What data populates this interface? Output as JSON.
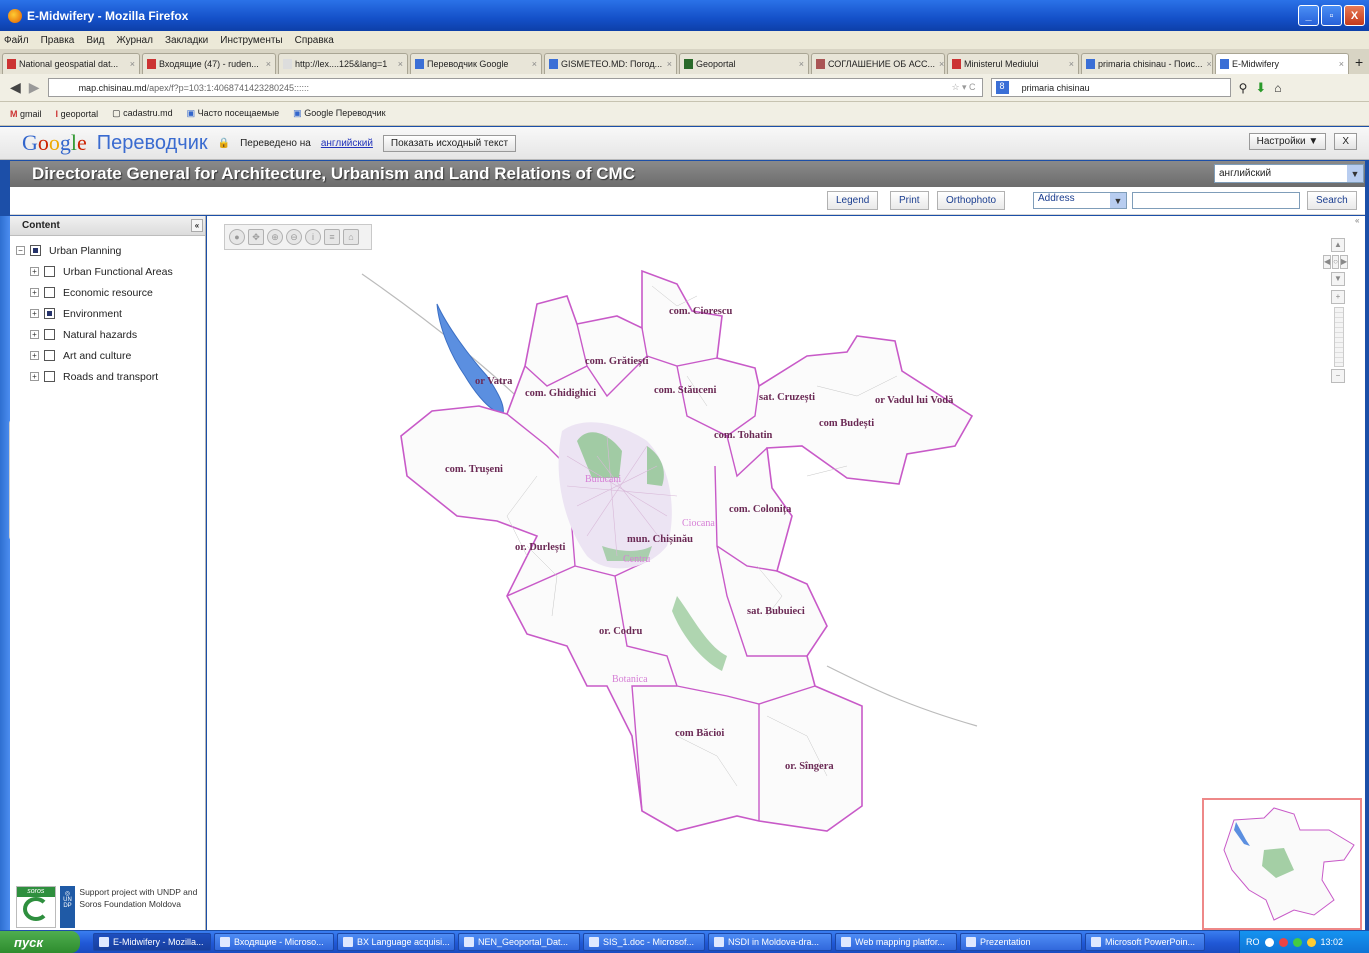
{
  "window": {
    "title": "E-Midwifery - Mozilla Firefox",
    "buttons": [
      "_",
      "▫",
      "X"
    ]
  },
  "menu": [
    "Файл",
    "Правка",
    "Вид",
    "Журнал",
    "Закладки",
    "Инструменты",
    "Справка"
  ],
  "tabs": [
    {
      "label": "National geospatial dat...",
      "w": 138
    },
    {
      "label": "Входящие (47) - ruden...",
      "w": 134
    },
    {
      "label": "http://lex....125&lang=1",
      "w": 130
    },
    {
      "label": "Переводчик Google",
      "w": 132
    },
    {
      "label": "GISMETEO.MD: Погод...",
      "w": 133
    },
    {
      "label": "Geoportal",
      "w": 130
    },
    {
      "label": "СОГЛАШЕНИЕ ОБ АСС...",
      "w": 134
    },
    {
      "label": "Ministerul Mediului",
      "w": 132
    },
    {
      "label": "primaria chisinau - Поис...",
      "w": 132
    },
    {
      "label": "E-Midwifery",
      "w": 134,
      "active": true
    }
  ],
  "nav": {
    "url_host": "map.chisinau.md",
    "url_path": "/apex/f?p=103:1:4068741423280245::::::",
    "search": "primaria chisinau"
  },
  "bookmarks": [
    "gmail",
    "geoportal",
    "cadastru.md",
    "Часто посещаемые",
    "Google Переводчик"
  ],
  "google_translate": {
    "logo": "Google",
    "name": "Переводчик",
    "translated_to": "Переведено на",
    "lang_link": "английский",
    "show_original": "Показать исходный текст",
    "settings": "Настройки ▼",
    "close": "X"
  },
  "app": {
    "header": "Directorate General for Architecture, Urbanism and Land Relations of CMC",
    "language": "английский"
  },
  "toolbar": {
    "legend": "Legend",
    "print": "Print",
    "orthophoto": "Orthophoto",
    "address": "Address",
    "search": "Search"
  },
  "sidebar": {
    "title": "Content",
    "root": "Urban Planning",
    "items": [
      "Urban Functional Areas",
      "Economic resource",
      "Environment",
      "Natural hazards",
      "Art and culture",
      "Roads and transport"
    ],
    "credit": "Support project with UNDP and Soros Foundation Moldova",
    "soros": "soros",
    "undp": "UN DP"
  },
  "map": {
    "labels": [
      {
        "text": "com. Ciorescu"
      },
      {
        "text": "com. Grătiești"
      },
      {
        "text": "com. Stăuceni"
      },
      {
        "text": "com. Ghidighici"
      },
      {
        "text": "or Vatra"
      },
      {
        "text": "sat. Cruzești"
      },
      {
        "text": "or Vadul lui Vodă"
      },
      {
        "text": "com Budești"
      },
      {
        "text": "com. Tohatin"
      },
      {
        "text": "com. Trușeni"
      },
      {
        "text": "com. Colonița"
      },
      {
        "text": "mun. Chișinău"
      },
      {
        "text": "or. Durlești"
      },
      {
        "text": "sat. Bubuieci"
      },
      {
        "text": "or. Codru"
      },
      {
        "text": "com Băcioi"
      },
      {
        "text": "or. Sîngera"
      },
      {
        "text": "Buiucani"
      },
      {
        "text": "Ciocana"
      },
      {
        "text": "Centru"
      },
      {
        "text": "Botanica"
      }
    ]
  },
  "taskbar": {
    "start": "пуск",
    "items": [
      "E-Midwifery - Mozilla...",
      "Входящие - Microso...",
      "BX Language acquisi...",
      "NEN_Geoportal_Dat...",
      "SIS_1.doc - Microsof...",
      "NSDI in Moldova-dra...",
      "Web mapping platfor...",
      "Prezentation",
      "Microsoft PowerPoin..."
    ],
    "lang": "RO",
    "time": "13:02"
  }
}
